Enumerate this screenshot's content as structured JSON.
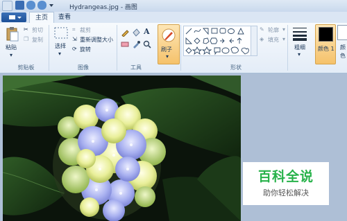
{
  "window": {
    "title": "Hydrangeas.jpg - 画图"
  },
  "tabs": [
    {
      "label": "主页"
    },
    {
      "label": "查看"
    }
  ],
  "clipboard": {
    "paste": "粘贴",
    "cut": "剪切",
    "copy": "复制",
    "group": "剪贴板"
  },
  "image": {
    "select": "选择",
    "crop": "裁剪",
    "resize": "重新调整大小",
    "rotate": "旋转",
    "group": "图像"
  },
  "tools": {
    "group": "工具",
    "text_glyph": "A"
  },
  "brushes": {
    "label": "刷子"
  },
  "shapes": {
    "outline": "轮廓",
    "fill": "填充",
    "group": "形状"
  },
  "size": {
    "label": "粗细"
  },
  "colors": {
    "color1": "颜色 1",
    "color2": "颜色"
  },
  "watermark": {
    "title": "百科全说",
    "subtitle": "助你轻松解决"
  },
  "colors_hex": {
    "accent_tab": "#1b4f97",
    "brush_active": "#f5c26b",
    "watermark_green": "#27b24a"
  }
}
